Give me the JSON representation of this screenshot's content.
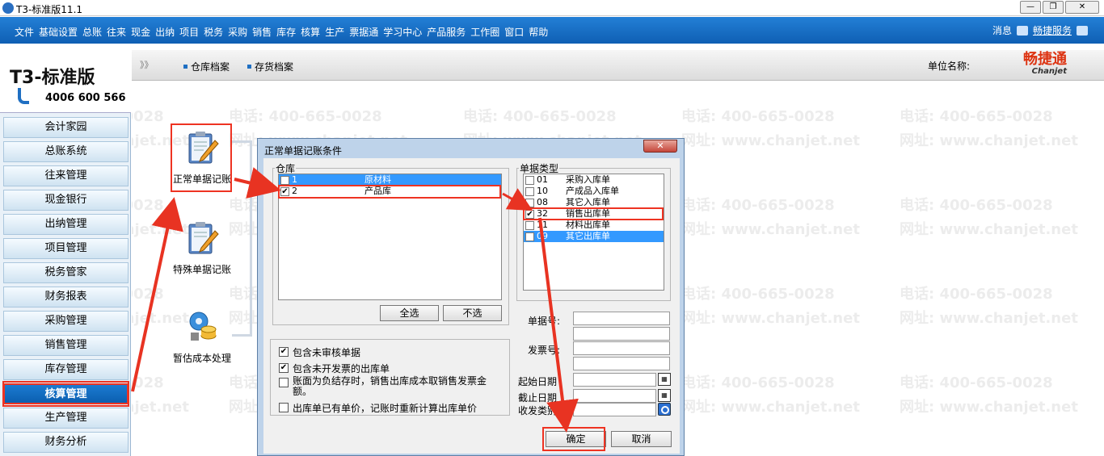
{
  "window": {
    "title": "T3-标准版11.1"
  },
  "menubar": {
    "items": [
      "文件",
      "基础设置",
      "总账",
      "往来",
      "现金",
      "出纳",
      "项目",
      "税务",
      "采购",
      "销售",
      "库存",
      "核算",
      "生产",
      "票据通",
      "学习中心",
      "产品服务",
      "工作圈",
      "窗口",
      "帮助"
    ],
    "messages": "消息",
    "chanjet_service": "畅捷服务"
  },
  "logo": {
    "brand": "T3-标准版",
    "phone": "4006 600 566"
  },
  "sidebar": {
    "items": [
      {
        "label": "会计家园"
      },
      {
        "label": "总账系统"
      },
      {
        "label": "往来管理"
      },
      {
        "label": "现金银行"
      },
      {
        "label": "出纳管理"
      },
      {
        "label": "项目管理"
      },
      {
        "label": "税务管家"
      },
      {
        "label": "财务报表"
      },
      {
        "label": "采购管理"
      },
      {
        "label": "销售管理"
      },
      {
        "label": "库存管理"
      },
      {
        "label": "核算管理"
      },
      {
        "label": "生产管理"
      },
      {
        "label": "财务分析"
      }
    ]
  },
  "tabstrip": {
    "arrows": "》》",
    "tabs": [
      {
        "label": "仓库档案"
      },
      {
        "label": "存货档案"
      }
    ],
    "unit_label": "单位名称:",
    "chanjet_cn": "畅捷通",
    "chanjet_en": "Chanjet"
  },
  "watermark": {
    "phone": "电话: 400-665-0028",
    "web": "网址: www.chanjet.net"
  },
  "functions": [
    {
      "label": "正常单据记账"
    },
    {
      "label": "特殊单据记账"
    },
    {
      "label": "暂估成本处理"
    }
  ],
  "dialog": {
    "title": "正常单据记账条件",
    "warehouse_legend": "仓库",
    "warehouses": [
      {
        "code": "1",
        "name": "原材料",
        "checked": false,
        "selected": true
      },
      {
        "code": "2",
        "name": "产品库",
        "checked": true,
        "selected": false
      }
    ],
    "select_all": "全选",
    "deselect": "不选",
    "doctype_legend": "单据类型",
    "doctypes": [
      {
        "code": "01",
        "name": "采购入库单",
        "checked": false,
        "selected": false
      },
      {
        "code": "10",
        "name": "产成品入库单",
        "checked": false,
        "selected": false
      },
      {
        "code": "08",
        "name": "其它入库单",
        "checked": false,
        "selected": false
      },
      {
        "code": "32",
        "name": "销售出库单",
        "checked": true,
        "selected": false
      },
      {
        "code": "11",
        "name": "材料出库单",
        "checked": false,
        "selected": false
      },
      {
        "code": "09",
        "name": "其它出库单",
        "checked": false,
        "selected": true
      }
    ],
    "options": [
      {
        "label": "包含未审核单据",
        "checked": true
      },
      {
        "label": "包含未开发票的出库单",
        "checked": true
      },
      {
        "label": "账面为负结存时，销售出库成本取销售发票金额。",
        "checked": false
      },
      {
        "label": "出库单已有单价，记账时重新计算出库单价",
        "checked": false
      }
    ],
    "fields": {
      "doc_no": "单据号:",
      "invoice_no": "发票号:",
      "start_date": "起始日期",
      "end_date": "截止日期",
      "category": "收发类别"
    },
    "ok": "确定",
    "cancel": "取消"
  },
  "colors": {
    "menu_blue": "#1a73cc",
    "highlight_red": "#e83322",
    "selection_blue": "#3399ff"
  }
}
